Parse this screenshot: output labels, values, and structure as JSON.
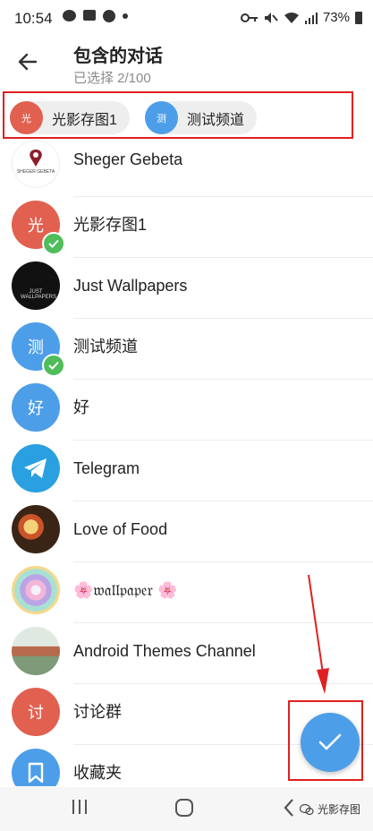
{
  "status_bar": {
    "time": "10:54",
    "battery": "73%"
  },
  "header": {
    "title": "包含的对话",
    "subtitle": "已选择 2/100"
  },
  "selected_chips": [
    {
      "avatar_text": "光",
      "label": "光影存图1",
      "color": "#e2604f"
    },
    {
      "avatar_text": "测",
      "label": "测试频道",
      "color": "#4d9ee8"
    }
  ],
  "chats": [
    {
      "name": "Sheger Gebeta",
      "avatar_text": "SHEGER GEBETA",
      "avatar_color": "#ffffff",
      "avatar_kind": "logo",
      "checked": false
    },
    {
      "name": "光影存图1",
      "avatar_text": "光",
      "avatar_color": "#e2604f",
      "avatar_kind": "letter",
      "checked": true
    },
    {
      "name": "Just Wallpapers",
      "avatar_text": "JUST WALLPAPERS",
      "avatar_color": "#111111",
      "avatar_kind": "logo-dark",
      "checked": false
    },
    {
      "name": "测试频道",
      "avatar_text": "测",
      "avatar_color": "#4d9ee8",
      "avatar_kind": "letter",
      "checked": true
    },
    {
      "name": "好",
      "avatar_text": "好",
      "avatar_color": "#4d9ee8",
      "avatar_kind": "letter",
      "checked": false
    },
    {
      "name": "Telegram",
      "avatar_text": "",
      "avatar_color": "#2aa0e0",
      "avatar_kind": "telegram",
      "checked": false
    },
    {
      "name": "Love of Food",
      "avatar_text": "",
      "avatar_color": "#5a3a22",
      "avatar_kind": "photo-food",
      "checked": false
    },
    {
      "name": "🌸𝔴𝔞𝔩𝔩𝔭𝔞𝔭𝔢𝔯 🌸",
      "avatar_text": "",
      "avatar_color": "#e8d6f0",
      "avatar_kind": "photo-flower",
      "checked": false
    },
    {
      "name": "Android Themes Channel",
      "avatar_text": "",
      "avatar_color": "#8fb0a0",
      "avatar_kind": "photo-room",
      "checked": false
    },
    {
      "name": "讨论群",
      "avatar_text": "讨",
      "avatar_color": "#e2604f",
      "avatar_kind": "letter",
      "checked": false
    },
    {
      "name": "收藏夹",
      "avatar_text": "",
      "avatar_color": "#4d9ee8",
      "avatar_kind": "bookmark",
      "checked": false
    }
  ],
  "watermark": "光影存图",
  "colors": {
    "accent": "#4d9ee8",
    "check_green": "#4fbd5a",
    "highlight_red": "#e02020"
  }
}
